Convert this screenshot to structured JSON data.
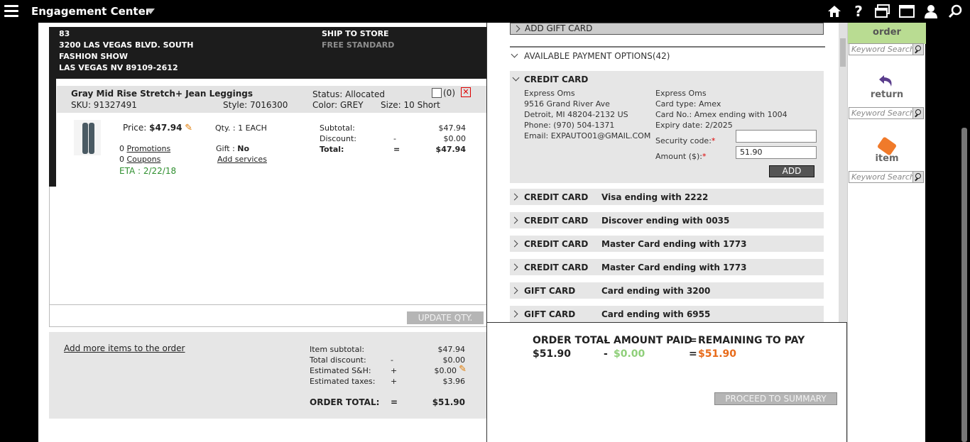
{
  "header": {
    "app_title": "Engagement Center"
  },
  "ship": {
    "address_lines": [
      "83",
      "3200 LAS VEGAS BLVD. SOUTH",
      "FASHION SHOW",
      "LAS VEGAS NV 89109-2612"
    ],
    "ship_to": "SHIP TO STORE",
    "shipping_method": "FREE STANDARD"
  },
  "item": {
    "name": "Gray Mid Rise Stretch+ Jean Leggings",
    "sku": "SKU: 91327491",
    "style": "Style: 7016300",
    "status": "Status: Allocated",
    "color": "Color: GREY",
    "size": "Size:   10 Short",
    "notes_count": "(0)",
    "price_label": "Price:",
    "price": "$47.94",
    "qty": "Qty. :  1  EACH",
    "promotions_count": "0",
    "promotions_label": "Promotions",
    "coupons_count": "0",
    "coupons_label": "Coupons",
    "eta": "ETA : 2/22/18",
    "gift_label": "Gift :",
    "gift_value": "No",
    "add_services": "Add services",
    "totals": [
      {
        "label": "Subtotal:",
        "op": "",
        "value": "$47.94"
      },
      {
        "label": "Discount:",
        "op": "-",
        "value": "$0.00"
      },
      {
        "label": "Total:",
        "op": "=",
        "value": "$47.94"
      }
    ],
    "update_qty": "UPDATE QTY."
  },
  "summary": {
    "add_more": "Add more items to the order",
    "rows": [
      {
        "label": "Item subtotal:",
        "op": "",
        "value": "$47.94"
      },
      {
        "label": "Total discount:",
        "op": "-",
        "value": "$0.00"
      },
      {
        "label": "Estimated S&H:",
        "op": "+",
        "value": "$0.00"
      },
      {
        "label": "Estimated taxes:",
        "op": "+",
        "value": "$3.96"
      }
    ],
    "grand_label": "ORDER TOTAL:",
    "grand_op": "=",
    "grand_value": "$51.90"
  },
  "payment": {
    "add_gift_card": "ADD GIFT CARD",
    "available_options": "AVAILABLE PAYMENT OPTIONS(42)",
    "open_card": {
      "title": "CREDIT CARD",
      "left_lines": [
        "Express Oms",
        "9516 Grand River Ave",
        "Detroit, MI 48204-2132 US",
        "Phone: (970) 504-1371",
        "Email:  EXPAUTO01@GMAIL.COM"
      ],
      "right_lines": [
        "Express Oms",
        "Card type:  Amex",
        "Card No.: Amex ending with 1004",
        "Expiry date: 2/2025"
      ],
      "security_label": "Security code:",
      "amount_label": "Amount ($):",
      "amount_value": "51.90",
      "add_label": "ADD"
    },
    "rows": [
      {
        "type": "CREDIT CARD",
        "desc": "Visa ending with 2222"
      },
      {
        "type": "CREDIT CARD",
        "desc": "Discover ending with 0035"
      },
      {
        "type": "CREDIT CARD",
        "desc": "Master Card ending with 1773"
      },
      {
        "type": "CREDIT CARD",
        "desc": "Master Card ending with 1773"
      },
      {
        "type": "GIFT CARD",
        "desc": "Card ending with 3200"
      },
      {
        "type": "GIFT CARD",
        "desc": "Card ending with 6955"
      }
    ]
  },
  "pay_summary": {
    "order_total_label": "ORDER TOTAL",
    "amount_paid_label": "AMOUNT PAID",
    "remaining_label": "REMAINING TO PAY",
    "minus": "-",
    "equals": "=",
    "order_total": "$51.90",
    "amount_paid": "$0.00",
    "remaining": "$51.90",
    "proceed": "PROCEED TO SUMMARY"
  },
  "sidebar": {
    "order_label": "order",
    "return_label": "return",
    "item_label": "item",
    "search_placeholder": "Keyword Search"
  },
  "colors": {
    "accent_green": "#b9dc92",
    "paid_green": "#8fcf7a",
    "remaining_orange": "#e86b1a",
    "eta_green": "#2f8f2f"
  }
}
